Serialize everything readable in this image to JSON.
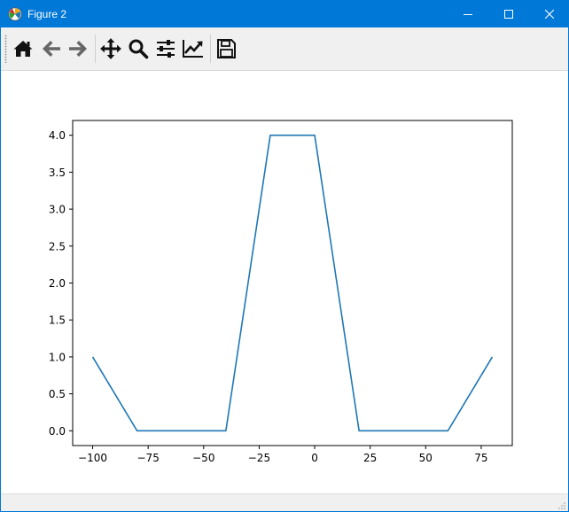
{
  "window": {
    "title": "Figure 2",
    "controls": [
      "minimize",
      "maximize",
      "close"
    ]
  },
  "toolbar": {
    "buttons": [
      {
        "name": "home",
        "icon": "home-icon"
      },
      {
        "name": "back",
        "icon": "arrow-left-icon"
      },
      {
        "name": "forward",
        "icon": "arrow-right-icon"
      },
      {
        "name": "pan",
        "icon": "move-icon"
      },
      {
        "name": "zoom",
        "icon": "magnifier-icon"
      },
      {
        "name": "configure-subplots",
        "icon": "sliders-icon"
      },
      {
        "name": "edit-axis",
        "icon": "chart-line-icon"
      },
      {
        "name": "save",
        "icon": "floppy-disk-icon"
      }
    ]
  },
  "status": {
    "text": ""
  },
  "colors": {
    "titlebar": "#0078d7",
    "line": "#1f77b4",
    "toolbar_bg": "#f0f0f0"
  },
  "chart_data": {
    "type": "line",
    "title": "",
    "xlabel": "",
    "ylabel": "",
    "xlim": [
      -109,
      89
    ],
    "ylim": [
      -0.2,
      4.2
    ],
    "xticks": [
      -100,
      -75,
      -50,
      -25,
      0,
      25,
      50,
      75
    ],
    "xtick_labels": [
      "−100",
      "−75",
      "−50",
      "−25",
      "0",
      "25",
      "50",
      "75"
    ],
    "yticks": [
      0.0,
      0.5,
      1.0,
      1.5,
      2.0,
      2.5,
      3.0,
      3.5,
      4.0
    ],
    "ytick_labels": [
      "0.0",
      "0.5",
      "1.0",
      "1.5",
      "2.0",
      "2.5",
      "3.0",
      "3.5",
      "4.0"
    ],
    "grid": false,
    "series": [
      {
        "x": [
          -100,
          -80,
          -60,
          -40,
          -20,
          0,
          20,
          40,
          60,
          80
        ],
        "y": [
          1,
          0,
          0,
          0,
          4,
          4,
          0,
          0,
          0,
          1
        ]
      }
    ]
  }
}
